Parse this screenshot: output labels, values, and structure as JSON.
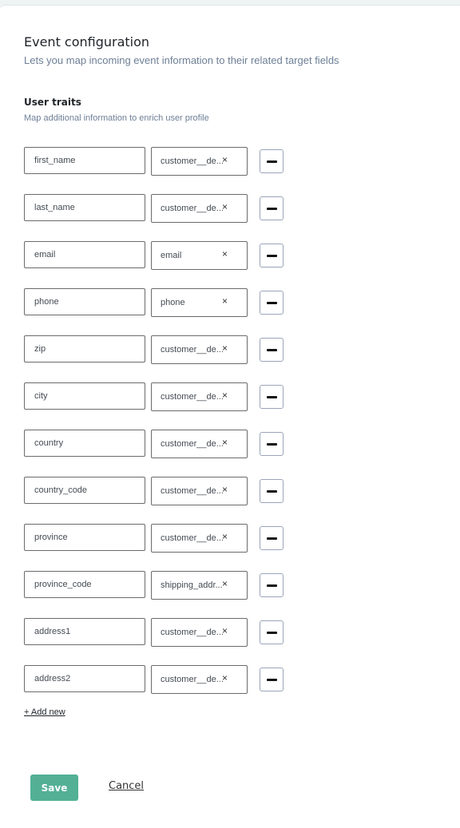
{
  "header": {
    "title": "Event configuration",
    "subtitle": "Lets you map incoming event information to their related target fields"
  },
  "section": {
    "title": "User traits",
    "subtitle": "Map additional information to enrich user profile"
  },
  "mappings": [
    {
      "source": "first_name",
      "target": "customer__de..."
    },
    {
      "source": "last_name",
      "target": "customer__de..."
    },
    {
      "source": "email",
      "target": "email"
    },
    {
      "source": "phone",
      "target": "phone"
    },
    {
      "source": "zip",
      "target": "customer__de..."
    },
    {
      "source": "city",
      "target": "customer__de..."
    },
    {
      "source": "country",
      "target": "customer__de..."
    },
    {
      "source": "country_code",
      "target": "customer__de..."
    },
    {
      "source": "province",
      "target": "customer__de..."
    },
    {
      "source": "province_code",
      "target": "shipping_addr..."
    },
    {
      "source": "address1",
      "target": "customer__de..."
    },
    {
      "source": "address2",
      "target": "customer__de..."
    }
  ],
  "icons": {
    "clear": "×",
    "remove": "minus-icon"
  },
  "actions": {
    "add_new": "+ Add new",
    "save": "Save",
    "cancel": "Cancel"
  },
  "colors": {
    "primary": "#53b095",
    "subtle_text": "#6e7f96"
  }
}
